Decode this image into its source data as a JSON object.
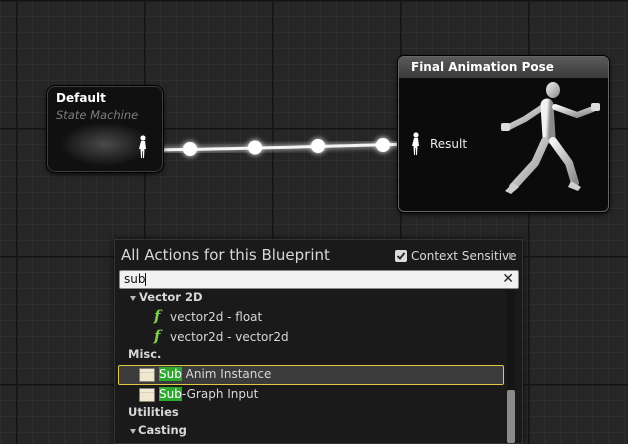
{
  "graph": {
    "state_machine_node": {
      "title": "Default",
      "subtitle": "State Machine",
      "pin_icon": "person-pin-icon"
    },
    "output_node": {
      "title": "Final Animation Pose",
      "pin_label": "Result",
      "pin_icon": "person-pin-icon",
      "preview_icon": "running-mannequin-icon"
    },
    "wire_color": "#ffffff"
  },
  "action_menu": {
    "heading": "All Actions for this Blueprint",
    "context_sensitive": {
      "label": "Context Sensitive",
      "checked": true
    },
    "search": {
      "value": "sub",
      "clear_icon": "close-icon"
    },
    "items": [
      {
        "kind": "category",
        "label": "Vector 2D",
        "expanded": true
      },
      {
        "kind": "function",
        "label": "vector2d - float",
        "icon": "function-icon"
      },
      {
        "kind": "function",
        "label": "vector2d - vector2d",
        "icon": "function-icon"
      },
      {
        "kind": "category",
        "label": "Misc.",
        "expanded": true
      },
      {
        "kind": "class",
        "match": "Sub",
        "rest": " Anim Instance",
        "icon": "node-icon",
        "selected": true
      },
      {
        "kind": "class",
        "match": "Sub",
        "rest": "-Graph Input",
        "icon": "node-icon",
        "selected": false
      },
      {
        "kind": "category",
        "label": "Utilities",
        "expanded": true
      },
      {
        "kind": "category",
        "label": "Casting",
        "expanded": true
      }
    ],
    "highlight_color": "#2fa82f",
    "selection_border_color": "#e0c840"
  }
}
